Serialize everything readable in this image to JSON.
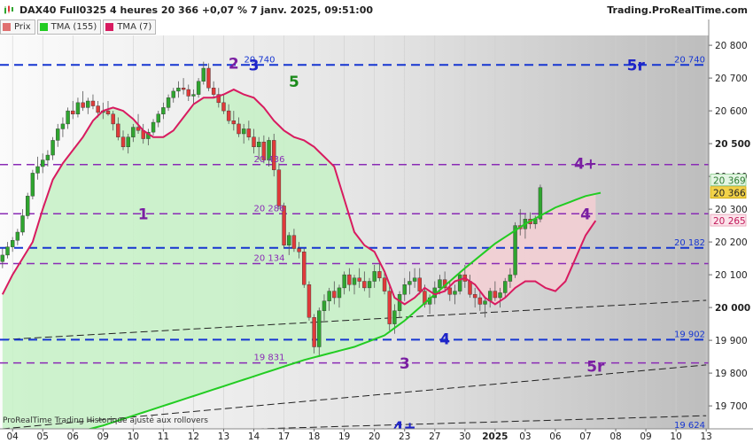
{
  "header": {
    "title": "DAX40 Full0325 4 heures 20 366 +0,07 % 7 janv. 2025, 09:51:00",
    "site": "Trading.ProRealTime.com"
  },
  "legend": [
    {
      "label": "Prix",
      "color": "#e07070"
    },
    {
      "label": "TMA (155)",
      "color": "#22cc22"
    },
    {
      "label": "TMA (7)",
      "color": "#d81b60"
    }
  ],
  "footer_note": "ProRealTime Trading Historique ajusté aux rollovers",
  "colors": {
    "up": "#2fa52f",
    "down": "#e03a3a",
    "wave_purple": "#7a1fa2",
    "wave_blue": "#1f24c8",
    "green_wave": "#1b8a1b",
    "blue_line": "#1636d1",
    "purple_line": "#8a2bb5",
    "tma155": "#22cc22",
    "tma7": "#d81b60",
    "fill_green": "#c6f1c6",
    "fill_red": "#f4cfd4"
  },
  "chart_data": {
    "type": "candlestick",
    "instrument": "DAX40 Full0325",
    "timeframe": "4 heures",
    "last_price": 20366,
    "change_pct": "+0,07 %",
    "ylim": [
      19630,
      20830
    ],
    "y_ticks": [
      "20 800",
      "20 700",
      "20 600",
      "20 500",
      "20 400",
      "20 300",
      "20 200",
      "20 100",
      "20 000",
      "19 900",
      "19 800",
      "19 700"
    ],
    "x_ticks": [
      {
        "label": "04",
        "i": 2
      },
      {
        "label": "05",
        "i": 8
      },
      {
        "label": "06",
        "i": 14
      },
      {
        "label": "09",
        "i": 20
      },
      {
        "label": "10",
        "i": 26
      },
      {
        "label": "11",
        "i": 32
      },
      {
        "label": "12",
        "i": 38
      },
      {
        "label": "13",
        "i": 44
      },
      {
        "label": "14",
        "i": 50
      },
      {
        "label": "17",
        "i": 56
      },
      {
        "label": "18",
        "i": 62
      },
      {
        "label": "19",
        "i": 68
      },
      {
        "label": "20",
        "i": 74
      },
      {
        "label": "23",
        "i": 80
      },
      {
        "label": "27",
        "i": 86
      },
      {
        "label": "30",
        "i": 92
      },
      {
        "label": "2025",
        "i": 98,
        "bold": true
      },
      {
        "label": "03",
        "i": 104
      },
      {
        "label": "06",
        "i": 110
      },
      {
        "label": "07",
        "i": 116
      },
      {
        "label": "08",
        "i": 122
      },
      {
        "label": "09",
        "i": 128
      },
      {
        "label": "10",
        "i": 134
      },
      {
        "label": "13",
        "i": 140
      }
    ],
    "price_badges": [
      {
        "label": "20 369",
        "value": 20369,
        "bg": "#e4f5e4",
        "fg": "#2e7d32",
        "border": "#88cc88"
      },
      {
        "label": "20 366",
        "value": 20366,
        "bg": "#f2d24a",
        "fg": "#222222",
        "border": "#c8a300"
      },
      {
        "label": "20 265",
        "value": 20265,
        "bg": "#fbe3ea",
        "fg": "#c2185b",
        "border": "#e79ab3"
      }
    ],
    "hlines": [
      {
        "value": 20740,
        "color": "#1636d1",
        "label_left": "20 740",
        "label_right": "20 740"
      },
      {
        "value": 20436,
        "color": "#8a2bb5",
        "label_left": "20 436"
      },
      {
        "value": 20286,
        "color": "#8a2bb5",
        "label_left": "20 286"
      },
      {
        "value": 20182,
        "color": "#1636d1",
        "label_right": "20 182"
      },
      {
        "value": 20134,
        "color": "#8a2bb5",
        "label_left": "20 134"
      },
      {
        "value": 19902,
        "color": "#1636d1",
        "label_right": "19 902"
      },
      {
        "value": 19831,
        "color": "#8a2bb5",
        "label_left": "19 831"
      },
      {
        "value": 19624,
        "color": "#1636d1",
        "label_right": "19 624"
      }
    ],
    "trendlines": [
      {
        "i1": 0,
        "v1": 19902,
        "i2": 140,
        "v2": 20022
      },
      {
        "i1": 0,
        "v1": 19630,
        "i2": 140,
        "v2": 19825
      },
      {
        "i1": 40,
        "v1": 19625,
        "i2": 140,
        "v2": 19670
      }
    ],
    "wave_labels": [
      {
        "text": "1",
        "i": 28,
        "v": 20285,
        "color": "#7a1fa2"
      },
      {
        "text": "2",
        "i": 46,
        "v": 20745,
        "color": "#7a1fa2"
      },
      {
        "text": "3",
        "i": 50,
        "v": 20740,
        "color": "#1f24c8"
      },
      {
        "text": "5",
        "i": 58,
        "v": 20690,
        "color": "#1b8a1b"
      },
      {
        "text": "3",
        "i": 80,
        "v": 19830,
        "color": "#7a1fa2"
      },
      {
        "text": "4",
        "i": 88,
        "v": 19905,
        "color": "#1f24c8"
      },
      {
        "text": "4+",
        "i": 116,
        "v": 20440,
        "color": "#7a1fa2"
      },
      {
        "text": "4",
        "i": 116,
        "v": 20285,
        "color": "#7a1fa2"
      },
      {
        "text": "5r",
        "i": 126,
        "v": 20740,
        "color": "#1f24c8"
      },
      {
        "text": "5r",
        "i": 118,
        "v": 19820,
        "color": "#7a1fa2"
      },
      {
        "text": "4+",
        "i": 80,
        "v": 19635,
        "color": "#1f24c8"
      }
    ],
    "tma155": [
      [
        0,
        19560
      ],
      [
        20,
        19640
      ],
      [
        40,
        19740
      ],
      [
        60,
        19840
      ],
      [
        70,
        19880
      ],
      [
        76,
        19915
      ],
      [
        80,
        19960
      ],
      [
        86,
        20040
      ],
      [
        92,
        20120
      ],
      [
        98,
        20195
      ],
      [
        104,
        20255
      ],
      [
        110,
        20305
      ],
      [
        116,
        20340
      ],
      [
        119,
        20350
      ]
    ],
    "tma7": [
      [
        0,
        20040
      ],
      [
        2,
        20100
      ],
      [
        4,
        20150
      ],
      [
        6,
        20200
      ],
      [
        8,
        20300
      ],
      [
        10,
        20390
      ],
      [
        12,
        20440
      ],
      [
        14,
        20480
      ],
      [
        16,
        20520
      ],
      [
        18,
        20570
      ],
      [
        20,
        20600
      ],
      [
        22,
        20610
      ],
      [
        24,
        20600
      ],
      [
        26,
        20575
      ],
      [
        28,
        20540
      ],
      [
        30,
        20520
      ],
      [
        32,
        20520
      ],
      [
        34,
        20540
      ],
      [
        36,
        20580
      ],
      [
        38,
        20620
      ],
      [
        40,
        20640
      ],
      [
        42,
        20640
      ],
      [
        44,
        20650
      ],
      [
        46,
        20665
      ],
      [
        48,
        20650
      ],
      [
        50,
        20640
      ],
      [
        52,
        20610
      ],
      [
        54,
        20570
      ],
      [
        56,
        20540
      ],
      [
        58,
        20520
      ],
      [
        60,
        20510
      ],
      [
        62,
        20490
      ],
      [
        64,
        20460
      ],
      [
        66,
        20430
      ],
      [
        68,
        20330
      ],
      [
        70,
        20230
      ],
      [
        72,
        20190
      ],
      [
        74,
        20170
      ],
      [
        76,
        20110
      ],
      [
        78,
        20030
      ],
      [
        80,
        20010
      ],
      [
        82,
        20030
      ],
      [
        84,
        20060
      ],
      [
        86,
        20040
      ],
      [
        88,
        20050
      ],
      [
        90,
        20080
      ],
      [
        92,
        20090
      ],
      [
        94,
        20070
      ],
      [
        96,
        20030
      ],
      [
        98,
        20010
      ],
      [
        100,
        20030
      ],
      [
        102,
        20060
      ],
      [
        104,
        20080
      ],
      [
        106,
        20080
      ],
      [
        108,
        20060
      ],
      [
        110,
        20050
      ],
      [
        112,
        20080
      ],
      [
        114,
        20150
      ],
      [
        116,
        20220
      ],
      [
        118,
        20265
      ]
    ],
    "candles": [
      [
        20140,
        20180,
        20120,
        20160
      ],
      [
        20160,
        20200,
        20150,
        20185
      ],
      [
        20185,
        20215,
        20170,
        20205
      ],
      [
        20205,
        20240,
        20190,
        20230
      ],
      [
        20230,
        20300,
        20220,
        20280
      ],
      [
        20280,
        20350,
        20270,
        20340
      ],
      [
        20340,
        20420,
        20330,
        20410
      ],
      [
        20410,
        20460,
        20390,
        20430
      ],
      [
        20430,
        20470,
        20410,
        20450
      ],
      [
        20450,
        20480,
        20430,
        20465
      ],
      [
        20465,
        20520,
        20450,
        20510
      ],
      [
        20510,
        20560,
        20490,
        20545
      ],
      [
        20545,
        20580,
        20520,
        20560
      ],
      [
        20560,
        20610,
        20545,
        20600
      ],
      [
        20600,
        20630,
        20575,
        20590
      ],
      [
        20590,
        20640,
        20580,
        20625
      ],
      [
        20625,
        20660,
        20600,
        20610
      ],
      [
        20610,
        20640,
        20590,
        20630
      ],
      [
        20630,
        20650,
        20605,
        20615
      ],
      [
        20615,
        20630,
        20580,
        20595
      ],
      [
        20595,
        20625,
        20575,
        20600
      ],
      [
        20600,
        20630,
        20585,
        20590
      ],
      [
        20590,
        20600,
        20540,
        20560
      ],
      [
        20560,
        20580,
        20510,
        20520
      ],
      [
        20520,
        20540,
        20480,
        20490
      ],
      [
        20490,
        20530,
        20470,
        20520
      ],
      [
        20520,
        20560,
        20505,
        20550
      ],
      [
        20550,
        20590,
        20530,
        20540
      ],
      [
        20540,
        20560,
        20500,
        20515
      ],
      [
        20515,
        20545,
        20495,
        20535
      ],
      [
        20535,
        20575,
        20525,
        20565
      ],
      [
        20565,
        20600,
        20550,
        20590
      ],
      [
        20590,
        20625,
        20575,
        20610
      ],
      [
        20610,
        20650,
        20600,
        20640
      ],
      [
        20640,
        20670,
        20625,
        20660
      ],
      [
        20660,
        20690,
        20640,
        20670
      ],
      [
        20670,
        20700,
        20650,
        20665
      ],
      [
        20665,
        20680,
        20630,
        20645
      ],
      [
        20645,
        20665,
        20620,
        20650
      ],
      [
        20650,
        20700,
        20640,
        20690
      ],
      [
        20690,
        20750,
        20680,
        20730
      ],
      [
        20730,
        20745,
        20660,
        20670
      ],
      [
        20670,
        20690,
        20640,
        20650
      ],
      [
        20650,
        20670,
        20610,
        20625
      ],
      [
        20625,
        20650,
        20590,
        20600
      ],
      [
        20600,
        20620,
        20560,
        20570
      ],
      [
        20570,
        20600,
        20540,
        20560
      ],
      [
        20560,
        20580,
        20520,
        20530
      ],
      [
        20530,
        20560,
        20500,
        20545
      ],
      [
        20545,
        20570,
        20510,
        20520
      ],
      [
        20520,
        20545,
        20470,
        20490
      ],
      [
        20490,
        20520,
        20450,
        20505
      ],
      [
        20505,
        20525,
        20440,
        20450
      ],
      [
        20450,
        20520,
        20430,
        20510
      ],
      [
        20510,
        20530,
        20400,
        20420
      ],
      [
        20420,
        20440,
        20300,
        20310
      ],
      [
        20310,
        20320,
        20180,
        20190
      ],
      [
        20190,
        20230,
        20160,
        20220
      ],
      [
        20220,
        20240,
        20170,
        20180
      ],
      [
        20180,
        20200,
        20150,
        20170
      ],
      [
        20170,
        20180,
        20060,
        20070
      ],
      [
        20070,
        20080,
        19960,
        19970
      ],
      [
        19970,
        19980,
        19860,
        19880
      ],
      [
        19880,
        20000,
        19850,
        19990
      ],
      [
        19990,
        20040,
        19960,
        20020
      ],
      [
        20020,
        20060,
        19990,
        20050
      ],
      [
        20050,
        20080,
        20010,
        20030
      ],
      [
        20030,
        20070,
        20000,
        20060
      ],
      [
        20060,
        20110,
        20040,
        20100
      ],
      [
        20100,
        20120,
        20050,
        20070
      ],
      [
        20070,
        20100,
        20040,
        20090
      ],
      [
        20090,
        20120,
        20060,
        20080
      ],
      [
        20080,
        20110,
        20050,
        20060
      ],
      [
        20060,
        20090,
        20030,
        20080
      ],
      [
        20080,
        20130,
        20060,
        20110
      ],
      [
        20110,
        20140,
        20080,
        20090
      ],
      [
        20090,
        20110,
        20040,
        20050
      ],
      [
        20050,
        20070,
        19930,
        19950
      ],
      [
        19950,
        20010,
        19920,
        19990
      ],
      [
        19990,
        20050,
        19970,
        20040
      ],
      [
        20040,
        20090,
        20020,
        20070
      ],
      [
        20070,
        20110,
        20040,
        20080
      ],
      [
        20080,
        20120,
        20060,
        20090
      ],
      [
        20090,
        20120,
        20040,
        20050
      ],
      [
        20050,
        20070,
        20000,
        20010
      ],
      [
        20010,
        20040,
        19980,
        20030
      ],
      [
        20030,
        20080,
        20010,
        20060
      ],
      [
        20060,
        20100,
        20040,
        20085
      ],
      [
        20085,
        20110,
        20050,
        20060
      ],
      [
        20060,
        20080,
        20020,
        20040
      ],
      [
        20040,
        20070,
        20010,
        20050
      ],
      [
        20050,
        20110,
        20040,
        20100
      ],
      [
        20100,
        20130,
        20060,
        20080
      ],
      [
        20080,
        20100,
        20030,
        20040
      ],
      [
        20040,
        20060,
        20000,
        20030
      ],
      [
        20030,
        20050,
        19990,
        20010
      ],
      [
        20010,
        20030,
        19970,
        20020
      ],
      [
        20020,
        20060,
        20000,
        20050
      ],
      [
        20050,
        20080,
        20020,
        20030
      ],
      [
        20030,
        20060,
        20000,
        20045
      ],
      [
        20045,
        20090,
        20030,
        20080
      ],
      [
        20080,
        20120,
        20060,
        20100
      ],
      [
        20100,
        20260,
        20090,
        20250
      ],
      [
        20250,
        20300,
        20220,
        20240
      ],
      [
        20240,
        20285,
        20210,
        20270
      ],
      [
        20270,
        20290,
        20240,
        20255
      ],
      [
        20255,
        20280,
        20240,
        20270
      ],
      [
        20270,
        20375,
        20260,
        20366
      ]
    ]
  }
}
